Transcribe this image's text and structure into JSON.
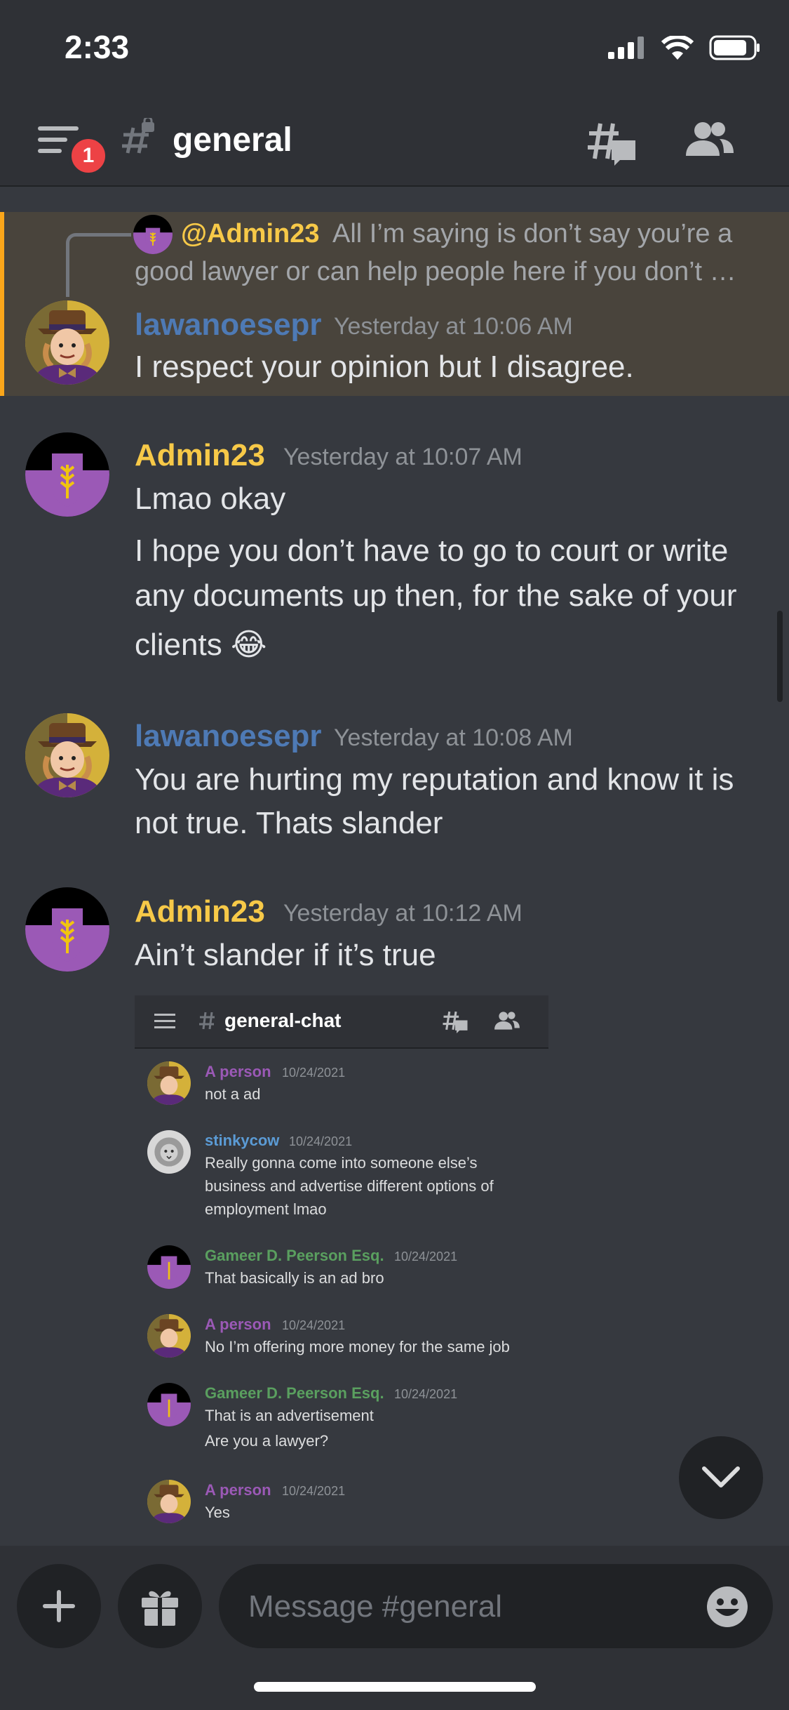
{
  "status_bar": {
    "time": "2:33"
  },
  "header": {
    "channel_name": "general",
    "notification_count": "1",
    "channel_icon": "locked-hashtag-icon"
  },
  "reply_preview": {
    "mention": "@Admin23",
    "text_line1": "All I’m saying is don’t say you’re a",
    "text_line2": "good lawyer or can help people here if you don’t …"
  },
  "messages": [
    {
      "author": "lawanoesepr",
      "timestamp": "Yesterday at 10:06 AM",
      "lines": [
        "I respect your opinion but I disagree."
      ]
    },
    {
      "author": "Admin23",
      "timestamp": "Yesterday at 10:07 AM",
      "lines": [
        "Lmao okay",
        "I hope you don’t have to go to court or write",
        "any documents up then, for the sake of your",
        "clients 😂"
      ]
    },
    {
      "author": "lawanoesepr",
      "timestamp": "Yesterday at 10:08 AM",
      "lines": [
        "You are hurting my reputation and know it is",
        "not true. Thats slander"
      ]
    },
    {
      "author": "Admin23",
      "timestamp": "Yesterday at 10:12 AM",
      "lines": [
        "Ain’t slander if it’s true"
      ]
    }
  ],
  "embedded_screenshot": {
    "channel": "general-chat",
    "messages": [
      {
        "author": "A person",
        "timestamp": "10/24/2021",
        "lines": [
          "not a ad"
        ]
      },
      {
        "author": "stinkycow",
        "timestamp": "10/24/2021",
        "lines": [
          "Really gonna come into someone else’s",
          "business and advertise different options of",
          "employment lmao"
        ]
      },
      {
        "author": "Gameer D. Peerson Esq.",
        "timestamp": "10/24/2021",
        "lines": [
          "That basically is an ad bro"
        ]
      },
      {
        "author": "A person",
        "timestamp": "10/24/2021",
        "lines": [
          "No I’m offering more money for the same job"
        ]
      },
      {
        "author": "Gameer D. Peerson Esq.",
        "timestamp": "10/24/2021",
        "lines": [
          "That is an advertisement",
          "Are you a lawyer?"
        ]
      },
      {
        "author": "A person",
        "timestamp": "10/24/2021",
        "lines": [
          "Yes"
        ]
      }
    ]
  },
  "composer": {
    "placeholder": "Message #general"
  },
  "colors": {
    "highlight_bar": "#faa61a",
    "admin_name": "#f7c948",
    "user_name": "#4e7ab5",
    "badge": "#ed4245"
  }
}
